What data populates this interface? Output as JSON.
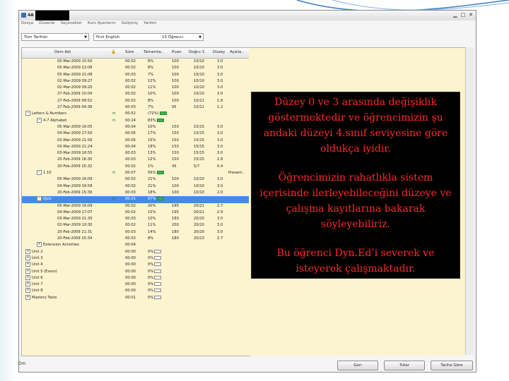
{
  "window": {
    "title": "4A",
    "menu": [
      "Dosya",
      "Düzenle",
      "Seçenekler",
      "Kurs Ayarlarını",
      "Gelişmiş",
      "Yardım"
    ],
    "filters": {
      "date_range": "Tüm Tarihler",
      "course": "First English",
      "student_count": "15 Öğrenci"
    },
    "buttons": {
      "back": "Geri",
      "total": "Tutar",
      "by_date": "Tarihe Göre"
    }
  },
  "table": {
    "headers": {
      "name": "Ders Adı",
      "time": "Süre",
      "completion": "Tamamla..",
      "score": "Puan",
      "accuracy": "Doğru Y..",
      "level": "Düzey",
      "note": "Açıkla.."
    },
    "rows": [
      {
        "indent": 2,
        "name": "05-Mar-2009  15:50",
        "time": "00:02",
        "completion": "8%",
        "score": "100",
        "accuracy": "10/10",
        "level": "3.0"
      },
      {
        "indent": 2,
        "name": "05-Mar-2009  22:08",
        "time": "00:02",
        "completion": "8%",
        "score": "100",
        "accuracy": "10/10",
        "level": "3.0"
      },
      {
        "indent": 2,
        "name": "05-Mar-2009  21:08",
        "time": "00:03",
        "completion": "7%",
        "score": "100",
        "accuracy": "10/10",
        "level": "3.0"
      },
      {
        "indent": 2,
        "name": "02-Mar-2009  09:27",
        "time": "00:02",
        "completion": "12%",
        "score": "100",
        "accuracy": "10/10",
        "level": "3.0"
      },
      {
        "indent": 2,
        "name": "02-Mar-2009  09:20",
        "time": "00:02",
        "completion": "11%",
        "score": "100",
        "accuracy": "10/10",
        "level": "3.0"
      },
      {
        "indent": 2,
        "name": "27-Feb-2009  10:04",
        "time": "00:02",
        "completion": "10%",
        "score": "100",
        "accuracy": "10/10",
        "level": "3.0"
      },
      {
        "indent": 2,
        "name": "27-Feb-2009  09:52",
        "time": "00:02",
        "completion": "8%",
        "score": "100",
        "accuracy": "10/11",
        "level": "1.6"
      },
      {
        "indent": 2,
        "name": "27-Feb-2009  09:39",
        "time": "00:03",
        "completion": "7%",
        "score": "95",
        "accuracy": "10/11",
        "level": "1.2"
      },
      {
        "indent": 0,
        "expander": "–",
        "name": "Letters & Numbers",
        "icon": true,
        "time": "00:52",
        "completion": "(72%)",
        "bar": "green",
        "score": "",
        "accuracy": "",
        "level": ""
      },
      {
        "indent": 1,
        "expander": "–",
        "name": "4-7 Alphabet",
        "icon": true,
        "time": "00:24",
        "completion": "83%",
        "bar": "green",
        "score": "",
        "accuracy": "",
        "level": ""
      },
      {
        "indent": 2,
        "name": "05-Mar-2009  16:05",
        "time": "00:04",
        "completion": "10%",
        "score": "150",
        "accuracy": "15/15",
        "level": "3.0"
      },
      {
        "indent": 2,
        "name": "04-Mar-2009  17:50",
        "time": "00:05",
        "completion": "17%",
        "score": "150",
        "accuracy": "15/15",
        "level": "3.0"
      },
      {
        "indent": 2,
        "name": "03-Mar-2009  21:56",
        "time": "00:05",
        "completion": "15%",
        "score": "150",
        "accuracy": "15/15",
        "level": "3.0"
      },
      {
        "indent": 2,
        "name": "03-Mar-2009  21:24",
        "time": "00:04",
        "completion": "18%",
        "score": "150",
        "accuracy": "15/15",
        "level": "3.0"
      },
      {
        "indent": 2,
        "name": "03-Mar-2009  16:55",
        "time": "00:03",
        "completion": "13%",
        "score": "150",
        "accuracy": "15/15",
        "level": "3.0"
      },
      {
        "indent": 2,
        "name": "20-Feb-2009  16:30",
        "time": "00:03",
        "completion": "12%",
        "score": "150",
        "accuracy": "15/15",
        "level": "2.8"
      },
      {
        "indent": 2,
        "name": "20-Feb-2009  15:32",
        "time": "00:02",
        "completion": "1%",
        "score": "45",
        "accuracy": "5/7",
        "level": "0.4"
      },
      {
        "indent": 1,
        "expander": "–",
        "name": "1.10",
        "icon": true,
        "time": "00:07",
        "completion": "56%",
        "bar": "green",
        "score": "",
        "accuracy": "",
        "level": "",
        "note": "Present.."
      },
      {
        "indent": 2,
        "name": "05-Mar-2009  16:09",
        "time": "00:02",
        "completion": "21%",
        "score": "100",
        "accuracy": "10/10",
        "level": "3.0"
      },
      {
        "indent": 2,
        "name": "04-Mar-2009  16:58",
        "time": "00:02",
        "completion": "21%",
        "score": "100",
        "accuracy": "10/10",
        "level": "3.0"
      },
      {
        "indent": 2,
        "name": "20-Feb-2009  15:39",
        "time": "00:03",
        "completion": "18%",
        "score": "100",
        "accuracy": "10/10",
        "level": "2.0"
      },
      {
        "indent": 1,
        "expander": "–",
        "name": "Quiz",
        "icon": true,
        "time": "00:21",
        "completion": "67%",
        "bar": "green",
        "score": "",
        "accuracy": "",
        "level": "",
        "selected": true
      },
      {
        "indent": 2,
        "name": "05-Mar-2009  16:09",
        "time": "00:02",
        "completion": "20%",
        "score": "195",
        "accuracy": "20/21",
        "level": "2.7"
      },
      {
        "indent": 2,
        "name": "04-Mar-2009  17:07",
        "time": "00:02",
        "completion": "15%",
        "score": "195",
        "accuracy": "20/21",
        "level": "2.9"
      },
      {
        "indent": 2,
        "name": "03-Mar-2009  21:30",
        "time": "00:03",
        "completion": "10%",
        "score": "180",
        "accuracy": "20/20",
        "level": "3.0"
      },
      {
        "indent": 2,
        "name": "02-Mar-2009  10:30",
        "time": "00:02",
        "completion": "11%",
        "score": "200",
        "accuracy": "20/20",
        "level": "3.0"
      },
      {
        "indent": 2,
        "name": "20-Feb-2009  21:31",
        "time": "00:03",
        "completion": "14%",
        "score": "180",
        "accuracy": "20/20",
        "level": "3.0"
      },
      {
        "indent": 2,
        "name": "20-Feb-2009  15:34",
        "time": "00:03",
        "completion": "8%",
        "score": "180",
        "accuracy": "20/23",
        "level": "2.7"
      },
      {
        "indent": 1,
        "expander": "+",
        "name": "Extension Activities",
        "time": "00:04",
        "completion": "",
        "score": "",
        "accuracy": "",
        "level": ""
      },
      {
        "indent": 0,
        "expander": "+",
        "name": "Unit 2",
        "time": "00:00",
        "completion": "0%",
        "bar": "empty",
        "score": "",
        "accuracy": "",
        "level": ""
      },
      {
        "indent": 0,
        "expander": "+",
        "name": "Unit 3",
        "time": "00:00",
        "completion": "0%",
        "bar": "empty",
        "score": "",
        "accuracy": "",
        "level": ""
      },
      {
        "indent": 0,
        "expander": "+",
        "name": "Unit 4",
        "time": "00:00",
        "completion": "0%",
        "bar": "empty",
        "score": "",
        "accuracy": "",
        "level": ""
      },
      {
        "indent": 0,
        "expander": "+",
        "name": "Unit 5 (Exam)",
        "time": "00:00",
        "completion": "0%",
        "bar": "empty",
        "score": "",
        "accuracy": "",
        "level": ""
      },
      {
        "indent": 0,
        "expander": "+",
        "name": "Unit 6",
        "time": "00:00",
        "completion": "0%",
        "bar": "empty",
        "score": "",
        "accuracy": "",
        "level": ""
      },
      {
        "indent": 0,
        "expander": "+",
        "name": "Unit 7",
        "time": "00:00",
        "completion": "0%",
        "bar": "empty",
        "score": "",
        "accuracy": "",
        "level": ""
      },
      {
        "indent": 0,
        "expander": "+",
        "name": "Unit 8",
        "time": "00:00",
        "completion": "0%",
        "bar": "empty",
        "score": "",
        "accuracy": "",
        "level": ""
      },
      {
        "indent": 0,
        "expander": "+",
        "name": "Mastery Tests",
        "time": "00:01",
        "completion": "0%",
        "bar": "empty",
        "score": "",
        "accuracy": "",
        "level": ""
      }
    ]
  },
  "overlay": {
    "paragraphs": [
      "Düzey 0 ve 3 arasında değişiklik göstermektedir ve öğrencimizin şu andaki düzeyi 4.sınıf seviyesine göre oldukça iyidir.",
      "Öğrencimizin rahatlıkla sistem içerisinde ilerleyebileceğini düzeye ve çalışma kayıtlarına bakarak söyleyebiliriz.",
      "Bu öğrenci Dyn.Ed’i severek ve isteyerek çalışmaktadır."
    ],
    "text_color": "#ff2a2a",
    "background": "#000000"
  },
  "statusbar": {
    "left_text": "Dm"
  },
  "colors": {
    "selection": "#3d8ee6",
    "grid_bg": "#fbf4cf",
    "progress": "#39b54a"
  }
}
